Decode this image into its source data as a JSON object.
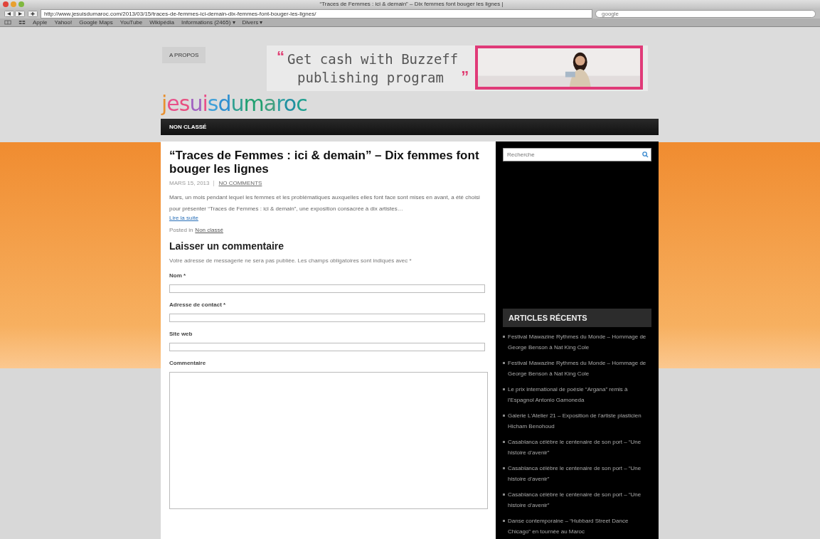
{
  "browser": {
    "title": "“Traces de Femmes : ici & demain” – Dix femmes font bouger les lignes |",
    "url": "http://www.jesuisdumaroc.com/2013/03/15/traces-de-femmes-ici-demain-dix-femmes-font-bouger-les-lignes/",
    "search_placeholder": "google",
    "bookmarks": [
      "Apple",
      "Yahoo!",
      "Google Maps",
      "YouTube",
      "Wikipédia",
      "Informations (2465) ▾",
      "Divers ▾"
    ]
  },
  "header": {
    "about_link": "A PROPOS",
    "logo": "jesuisdumaroc",
    "ad": {
      "open_quote": "“",
      "line_1": "Get cash with Buzzeff",
      "line_2": "publishing program",
      "close_quote": "”"
    },
    "nav": [
      "NON CLASSÉ"
    ]
  },
  "post": {
    "title": "“Traces de Femmes : ici & demain” – Dix femmes font bouger les lignes",
    "date": "MARS 15, 2013",
    "comments_link": "NO COMMENTS",
    "excerpt": "Mars, un mois pendant lequel les femmes et les problématiques auxquelles elles font face sont mises en avant, a été choisi pour présenter “Traces de Femmes : ici & demain”, une exposition consacrée à dix artistes…",
    "read_more": "Lire la suite",
    "posted_in": "Posted in",
    "category": "Non classé"
  },
  "comment_form": {
    "heading": "Laisser un commentaire",
    "note": "Votre adresse de messagerie ne sera pas publiée. Les champs obligatoires sont indiqués avec *",
    "fields": [
      {
        "label": "Nom *",
        "kind": "line"
      },
      {
        "label": "Adresse de contact *",
        "kind": "line"
      },
      {
        "label": "Site web",
        "kind": "line"
      },
      {
        "label": "Commentaire",
        "kind": "area"
      }
    ]
  },
  "sidebar": {
    "search_placeholder": "Recherche",
    "recent_heading": "ARTICLES RÉCENTS",
    "recent": [
      "Festival Mawazine Rythmes du Monde – Hommage de George Benson à Nat King Cole",
      "Festival Mawazine Rythmes du Monde – Hommage de George Benson à Nat King Cole",
      "Le prix international de poésie “Argana” remis à l'Espagnol Antonio Gamoneda",
      "Galerie L'Atelier 21 – Exposition de l'artiste plasticien Hicham Benohoud",
      "Casablanca célèbre le centenaire de son port – “Une histoire d'avenir”",
      "Casablanca célèbre le centenaire de son port – “Une histoire d'avenir”",
      "Casablanca célèbre le centenaire de son port – “Une histoire d'avenir”",
      "Danse contemporaine – “Hubbard Street Dance Chicago” en tournée au Maroc"
    ]
  }
}
